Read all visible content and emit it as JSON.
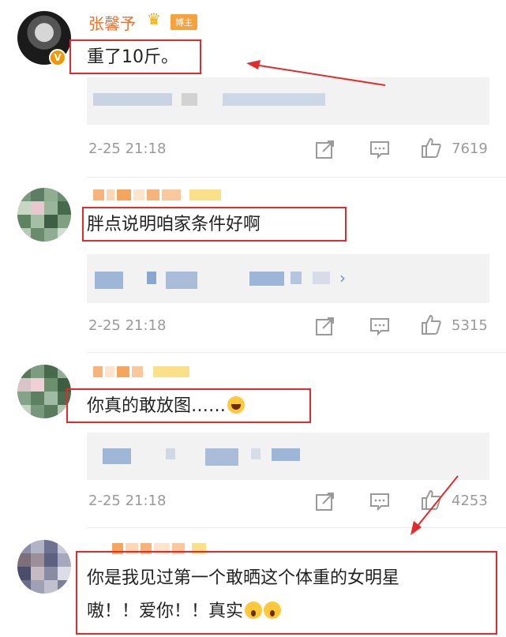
{
  "comments": [
    {
      "username": "张馨予",
      "badge": "博主",
      "verified": "V",
      "text": "重了10斤。",
      "time": "2-25 21:18",
      "likes": "7619"
    },
    {
      "text": "胖点说明咱家条件好啊",
      "time": "2-25 21:18",
      "likes": "5315"
    },
    {
      "text": "你真的敢放图……",
      "time": "2-25 21:18",
      "likes": "4253"
    },
    {
      "text_line1": "你是我见过第一个敢晒这个体重的女明星",
      "text_line2": "嗷！！爱你！！真实"
    }
  ],
  "icons": {
    "share": "share-icon",
    "comment": "comment-icon",
    "like": "thumbs-up-icon",
    "crown": "crown-icon"
  },
  "colors": {
    "highlight": "#e32b2b",
    "username": "#e8722f",
    "meta": "#9a9a9a",
    "badge": "#f7a23d"
  }
}
